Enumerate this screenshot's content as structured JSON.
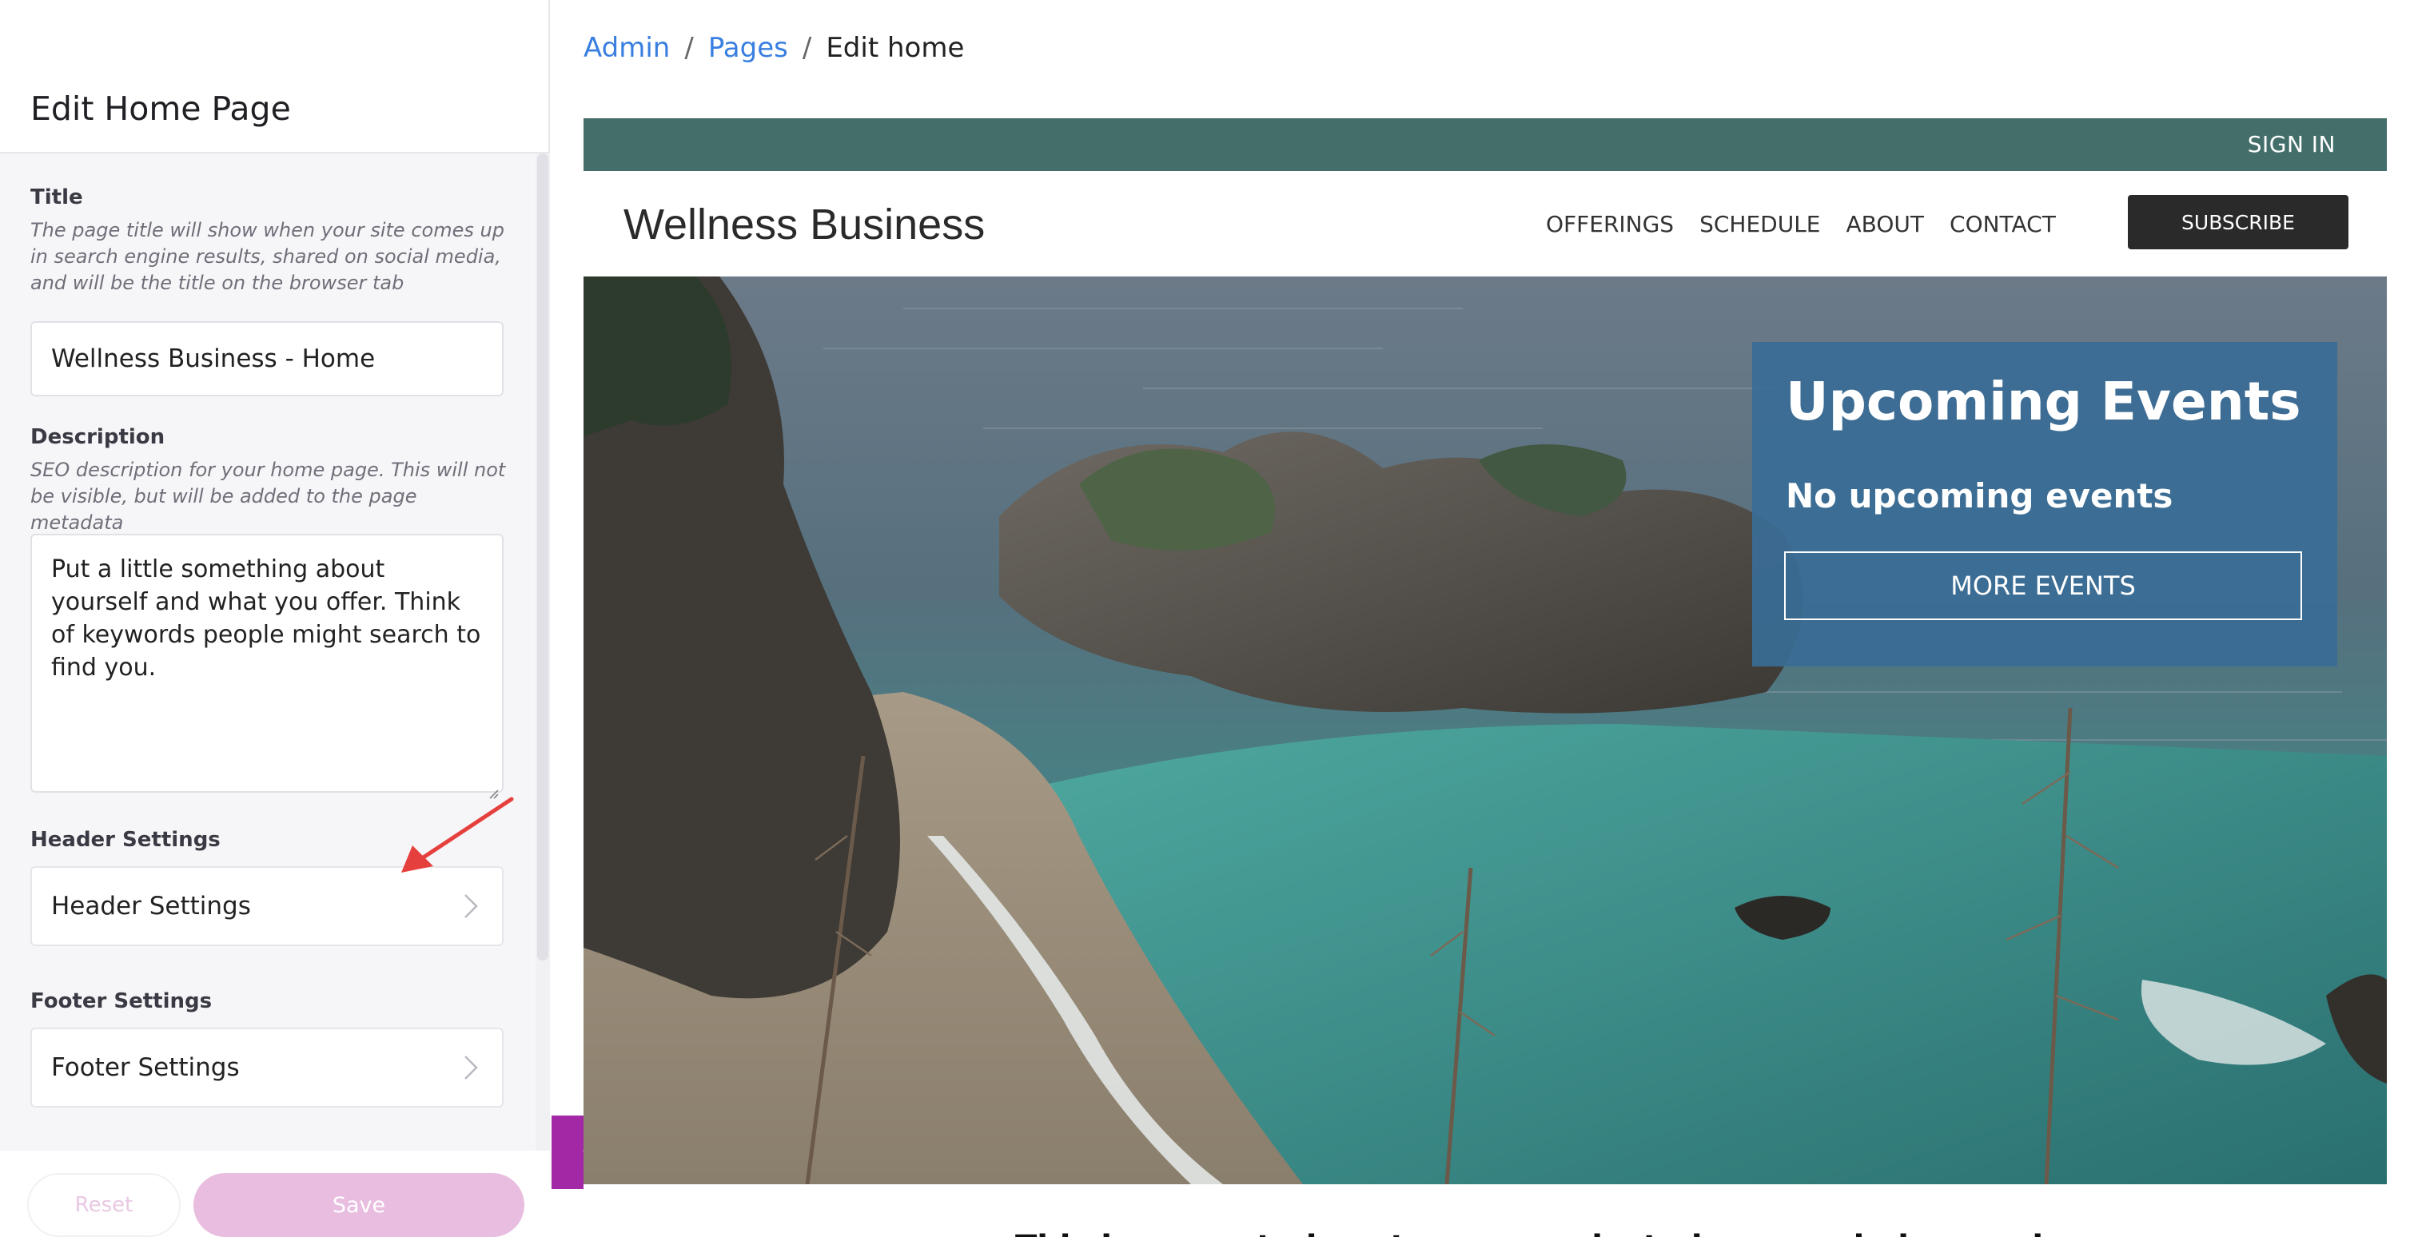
{
  "panel": {
    "title": "Edit Home Page",
    "fields": {
      "title_label": "Title",
      "title_help": "The page title will show when your site comes up in search engine results, shared on social media, and will be the title on the browser tab",
      "title_value": "Wellness Business - Home",
      "description_label": "Description",
      "description_help": "SEO description for your home page. This will not be visible, but will be added to the page metadata",
      "description_value": "Put a little something about yourself and what you offer. Think of keywords people might search to find you.",
      "header_label": "Header Settings",
      "header_row": "Header Settings",
      "footer_label": "Footer Settings",
      "footer_row": "Footer Settings"
    },
    "footer": {
      "reset_label": "Reset",
      "save_label": "Save"
    }
  },
  "breadcrumb": {
    "admin": "Admin",
    "sep": "/",
    "pages": "Pages",
    "current": "Edit home"
  },
  "site": {
    "signin": "SIGN IN",
    "logo": "Wellness Business",
    "nav": [
      "OFFERINGS",
      "SCHEDULE",
      "ABOUT",
      "CONTACT"
    ],
    "subscribe": "SUBSCRIBE",
    "events": {
      "title": "Upcoming Events",
      "subtitle": "No upcoming events",
      "button": "MORE EVENTS"
    },
    "below_text": "This is a great place to communicate how you help people"
  },
  "colors": {
    "accent": "#a228a6",
    "topbar": "#446e6a",
    "link": "#3a7fe0",
    "events_card": "#3a6c96"
  },
  "icons": {
    "chevron_right": "chevron-right-icon",
    "collapse": "chevron-left-icon",
    "annotation": "red-arrow-icon"
  }
}
